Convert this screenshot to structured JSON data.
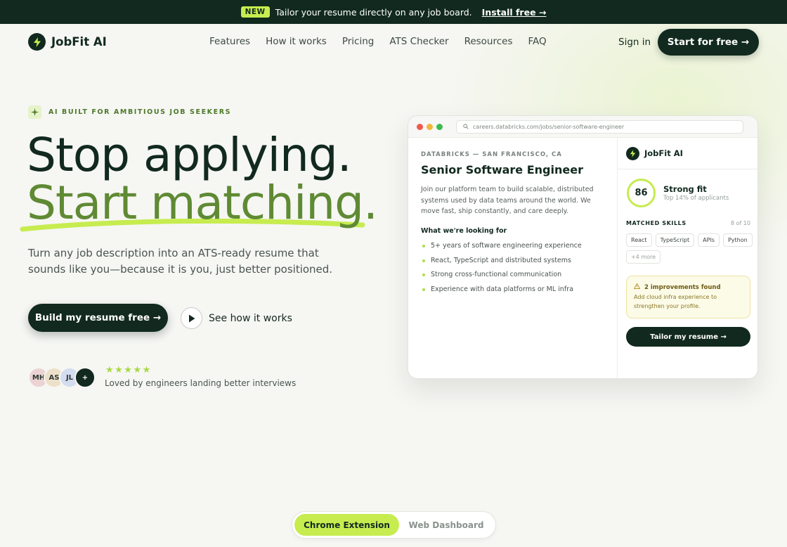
{
  "announcement": {
    "badge": "NEW",
    "text": "Tailor your resume directly on any job board.",
    "link": "Install free →"
  },
  "header": {
    "brand": "JobFit AI",
    "nav": [
      "Features",
      "How it works",
      "Pricing",
      "ATS Checker",
      "Resources",
      "FAQ"
    ],
    "signin": "Sign in",
    "cta": "Start for free →"
  },
  "hero": {
    "eyebrow": "AI BUILT FOR AMBITIOUS JOB SEEKERS",
    "headline_1": "Stop applying.",
    "headline_2": "Start matching.",
    "subtitle": "Turn any job description into an ATS-ready resume that sounds like you—because it is you, just better positioned.",
    "primary_button": "Build my resume free →",
    "secondary_button": "See how it works",
    "avatars": [
      {
        "initials": "MH",
        "color": "#ecd3d3"
      },
      {
        "initials": "AS",
        "color": "#ece0c9"
      },
      {
        "initials": "JL",
        "color": "#d4dcef"
      },
      {
        "initials": "+",
        "color": "#11291e"
      }
    ],
    "stars": "★★★★★",
    "social_proof": "Loved by engineers landing better interviews"
  },
  "browser": {
    "url": "careers.databricks.com/jobs/senior-software-engineer",
    "job": {
      "company": "DATABRICKS — SAN FRANCISCO, CA",
      "title": "Senior Software Engineer",
      "description": "Join our platform team to build scalable, distributed systems used by data teams around the world. We move fast, ship constantly, and care deeply.",
      "requirements_heading": "What we're looking for",
      "requirements": [
        "5+ years of software engineering experience",
        "React, TypeScript and distributed systems",
        "Strong cross-functional communication",
        "Experience with data platforms or ML infra"
      ]
    },
    "panel": {
      "brand": "JobFit AI",
      "score": "86",
      "fit_label": "Strong fit",
      "fit_sub": "Top 14% of applicants",
      "skills_label": "MATCHED SKILLS",
      "skills_count": "8 of 10",
      "skills": [
        "React",
        "TypeScript",
        "APIs",
        "Python",
        "+4 more"
      ],
      "warning_title": "2 improvements found",
      "warning_body": "Add cloud infra experience to strengthen your profile.",
      "button": "Tailor my resume →"
    }
  },
  "toggle": {
    "active": "Chrome Extension",
    "inactive": "Web Dashboard"
  },
  "colors": {
    "brand_dark": "#11291e",
    "accent_lime": "#c6ec4f",
    "accent_green": "#5f8a34"
  }
}
